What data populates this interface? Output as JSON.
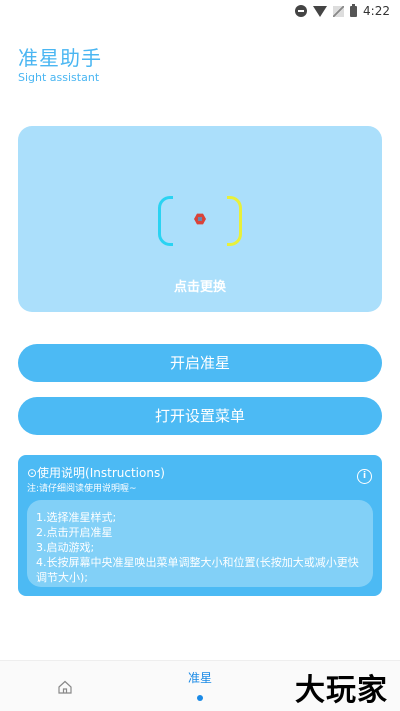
{
  "status_bar": {
    "time": "4:22"
  },
  "header": {
    "title": "准星助手",
    "subtitle": "Sight assistant"
  },
  "preview": {
    "change_label": "点击更换"
  },
  "buttons": {
    "start": "开启准星",
    "settings": "打开设置菜单"
  },
  "instructions": {
    "title": "⊙使用说明(Instructions)",
    "note": "注:请仔细阅读使用说明喔~",
    "info_icon": "i",
    "items": [
      "1.选择准星样式;",
      "2.点击开启准星",
      "3.启动游戏;",
      "4.长按屏幕中央准星唤出菜单调整大小和位置(长按加大或减小更快调节大小);"
    ]
  },
  "bottom_nav": {
    "active_label": "准星",
    "watermark": "大玩家"
  },
  "colors": {
    "accent": "#4cbaf4",
    "card": "#abdffb",
    "active": "#1a8ae6"
  }
}
